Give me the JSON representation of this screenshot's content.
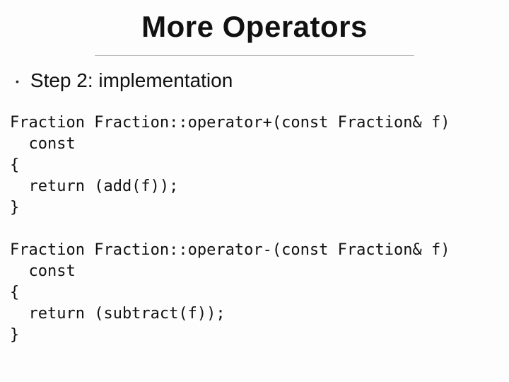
{
  "title": "More Operators",
  "bullet": "•",
  "step": "Step 2:  implementation",
  "code1": "Fraction Fraction::operator+(const Fraction& f)\n  const\n{\n  return (add(f));\n}",
  "code2": "Fraction Fraction::operator-(const Fraction& f)\n  const\n{\n  return (subtract(f));\n}"
}
